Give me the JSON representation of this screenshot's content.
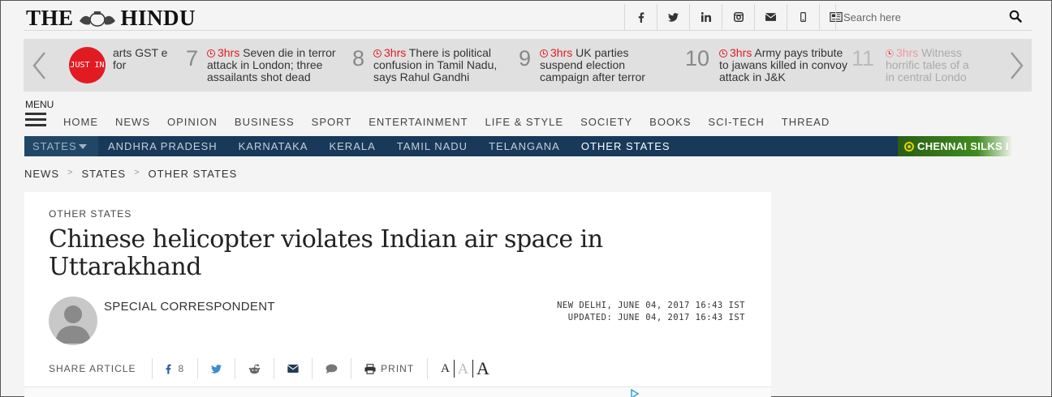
{
  "header": {
    "logo_left": "THE",
    "logo_right": "HINDU",
    "search_placeholder": "Search here"
  },
  "socials": [
    {
      "name": "facebook-icon",
      "glyph": "f"
    },
    {
      "name": "twitter-icon",
      "glyph": "t"
    },
    {
      "name": "linkedin-icon",
      "glyph": "in"
    },
    {
      "name": "instagram-icon",
      "glyph": "ig"
    },
    {
      "name": "email-icon",
      "glyph": "mail"
    },
    {
      "name": "mobile-icon",
      "glyph": "mob"
    },
    {
      "name": "epaper-icon",
      "glyph": "paper"
    }
  ],
  "ticker": {
    "badge": "JUST IN",
    "items": [
      {
        "num": "",
        "time": "",
        "text": "arts GST e for"
      },
      {
        "num": "7",
        "time": "3hrs",
        "text": "Seven die in terror attack in London; three assailants shot dead"
      },
      {
        "num": "8",
        "time": "3hrs",
        "text": "There is political confusion in Tamil Nadu, says Rahul Gandhi"
      },
      {
        "num": "9",
        "time": "3hrs",
        "text": "UK parties suspend election campaign after terror"
      },
      {
        "num": "10",
        "time": "3hrs",
        "text": "Army pays tribute to jawans killed in convoy attack in J&K"
      },
      {
        "num": "11",
        "time": "3hrs",
        "text": "Witness horrific tales of a in central Londo"
      }
    ]
  },
  "nav": {
    "menu_label": "MENU",
    "items": [
      "HOME",
      "NEWS",
      "OPINION",
      "BUSINESS",
      "SPORT",
      "ENTERTAINMENT",
      "LIFE & STYLE",
      "SOCIETY",
      "BOOKS",
      "SCI-TECH",
      "THREAD"
    ]
  },
  "states": {
    "label": "STATES",
    "items": [
      "ANDHRA PRADESH",
      "KARNATAKA",
      "KERALA",
      "TAMIL NADU",
      "TELANGANA",
      "OTHER STATES"
    ],
    "active_index": 5,
    "promo": "CHENNAI SILKS I"
  },
  "breadcrumb": [
    "NEWS",
    "STATES",
    "OTHER STATES"
  ],
  "article": {
    "kicker": "OTHER STATES",
    "headline": "Chinese helicopter violates Indian air space in Uttarakhand",
    "author": "SPECIAL CORRESPONDENT",
    "dateline": "NEW DELHI, JUNE 04, 2017 16:43 IST",
    "updated": "UPDATED: JUNE 04, 2017 16:43 IST"
  },
  "share": {
    "label": "SHARE ARTICLE",
    "fb_count": "8",
    "print_label": "PRINT",
    "font_sizes": [
      "A",
      "A",
      "A"
    ]
  },
  "colors": {
    "brand_red": "#e21b23",
    "nav_blue": "#18395a",
    "promo_green": "#3f8c1e"
  }
}
